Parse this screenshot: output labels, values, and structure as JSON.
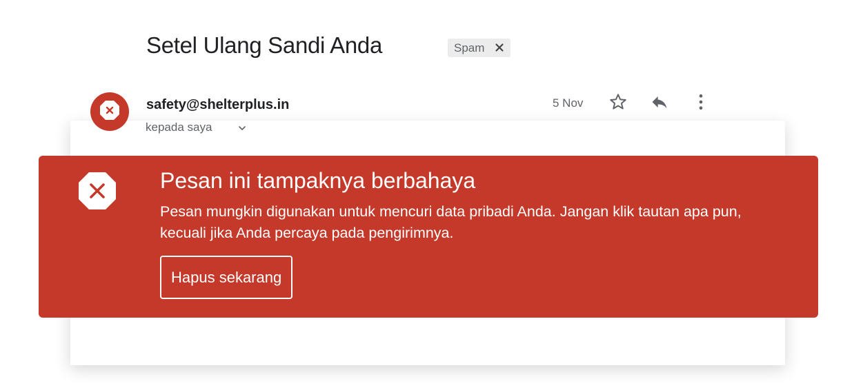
{
  "email": {
    "subject": "Setel Ulang Sandi Anda",
    "label": "Spam",
    "sender": "safety@shelterplus.in",
    "recipient": "kepada saya",
    "date": "5 Nov"
  },
  "warning": {
    "title": "Pesan ini tampaknya berbahaya",
    "message": "Pesan mungkin digunakan untuk mencuri data pribadi Anda. Jangan klik tautan apa pun, kecuali jika Anda percaya pada pengirimnya.",
    "button_label": "Hapus sekarang"
  },
  "colors": {
    "danger": "#c5392a",
    "chip_background": "#ececec",
    "secondary_text": "#5f6368"
  },
  "icons": {
    "avatar": "danger-octagon-icon",
    "label_close": "close-icon",
    "details_toggle": "chevron-down-icon",
    "star": "star-outline-icon",
    "reply": "reply-icon",
    "more": "more-vertical-icon",
    "warning": "danger-octagon-icon"
  }
}
